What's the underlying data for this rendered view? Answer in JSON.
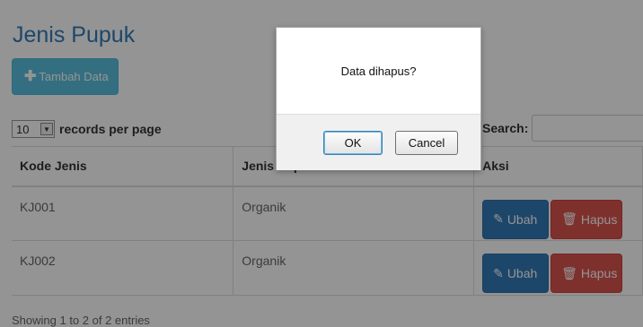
{
  "page": {
    "title": "Jenis Pupuk",
    "add_button": "Tambah Data"
  },
  "table_controls": {
    "length_value": "10",
    "length_suffix": "records per page",
    "search_label": "Search:",
    "search_value": ""
  },
  "table": {
    "columns": [
      "Kode Jenis",
      "Jenis Pupuk",
      "Aksi"
    ],
    "rows": [
      {
        "kode": "KJ001",
        "jenis": "Organik",
        "edit": "Ubah",
        "delete": "Hapus"
      },
      {
        "kode": "KJ002",
        "jenis": "Organik",
        "edit": "Ubah",
        "delete": "Hapus"
      }
    ],
    "info": "Showing 1 to 2 of 2 entries"
  },
  "dialog": {
    "message": "Data dihapus?",
    "ok": "OK",
    "cancel": "Cancel"
  },
  "colors": {
    "primary": "#337ab7",
    "info": "#5bc0de",
    "danger": "#d9534f"
  },
  "icons": [
    "plus-icon",
    "chevron-down-icon",
    "edit-icon",
    "trash-icon"
  ]
}
